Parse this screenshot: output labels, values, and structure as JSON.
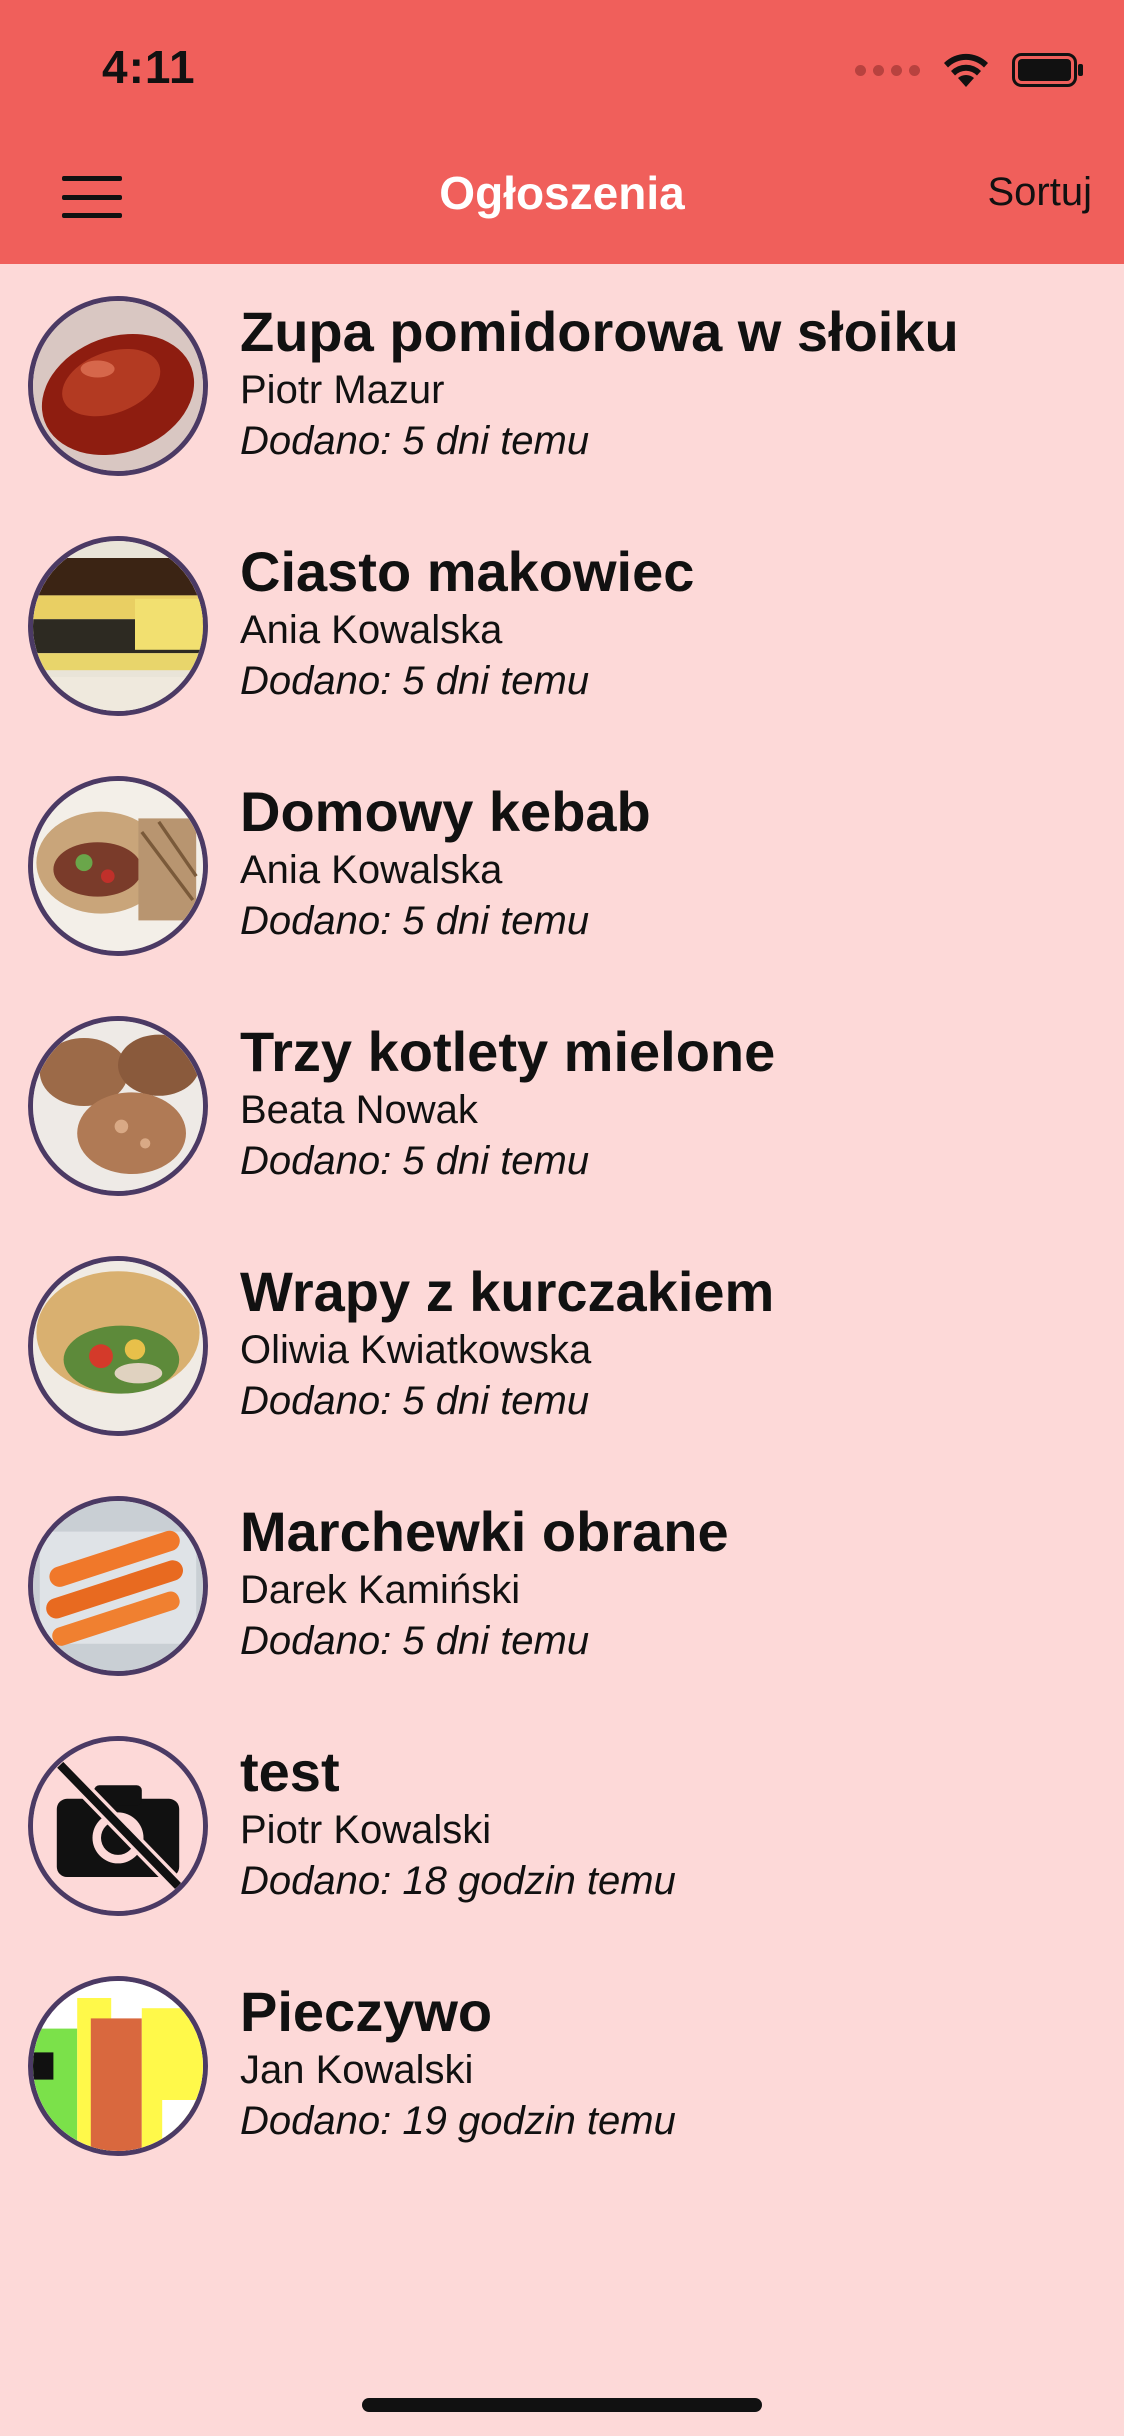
{
  "status_bar": {
    "time": "4:11"
  },
  "header": {
    "title": "Ogłoszenia",
    "sort_label": "Sortuj"
  },
  "items": [
    {
      "title": "Zupa pomidorowa w słoiku",
      "author": "Piotr Mazur",
      "date": "Dodano: 5 dni temu"
    },
    {
      "title": "Ciasto makowiec",
      "author": "Ania Kowalska",
      "date": "Dodano: 5 dni temu"
    },
    {
      "title": "Domowy kebab",
      "author": "Ania Kowalska",
      "date": "Dodano: 5 dni temu"
    },
    {
      "title": "Trzy kotlety mielone",
      "author": "Beata Nowak",
      "date": "Dodano: 5 dni temu"
    },
    {
      "title": "Wrapy z kurczakiem",
      "author": "Oliwia Kwiatkowska",
      "date": "Dodano: 5 dni temu"
    },
    {
      "title": "Marchewki obrane",
      "author": "Darek Kamiński",
      "date": "Dodano: 5 dni temu"
    },
    {
      "title": "test",
      "author": "Piotr Kowalski",
      "date": "Dodano: 18 godzin temu"
    },
    {
      "title": "Pieczywo",
      "author": "Jan Kowalski",
      "date": "Dodano: 19 godzin temu"
    }
  ],
  "colors": {
    "header": "#f05f5b",
    "background": "#fdd9d8",
    "thumb_border": "#4b3a64"
  }
}
